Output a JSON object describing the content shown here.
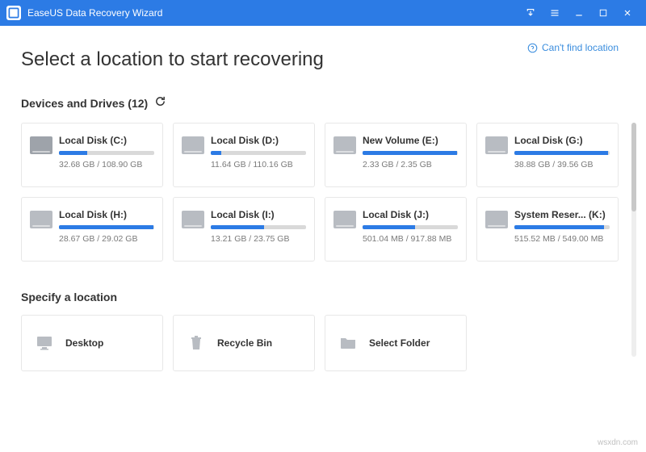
{
  "titlebar": {
    "app_name": "EaseUS Data Recovery Wizard"
  },
  "help_link": "Can't find location",
  "heading": "Select a location to start recovering",
  "drives_section": {
    "title": "Devices and Drives (12)"
  },
  "drives": [
    {
      "name": "Local Disk (C:)",
      "used": "32.68 GB",
      "total": "108.90 GB",
      "pct": 30,
      "os": true
    },
    {
      "name": "Local Disk (D:)",
      "used": "11.64 GB",
      "total": "110.16 GB",
      "pct": 11,
      "os": false
    },
    {
      "name": "New Volume (E:)",
      "used": "2.33 GB",
      "total": "2.35 GB",
      "pct": 99,
      "os": false
    },
    {
      "name": "Local Disk (G:)",
      "used": "38.88 GB",
      "total": "39.56 GB",
      "pct": 98,
      "os": false
    },
    {
      "name": "Local Disk (H:)",
      "used": "28.67 GB",
      "total": "29.02 GB",
      "pct": 99,
      "os": false
    },
    {
      "name": "Local Disk (I:)",
      "used": "13.21 GB",
      "total": "23.75 GB",
      "pct": 56,
      "os": false
    },
    {
      "name": "Local Disk (J:)",
      "used": "501.04 MB",
      "total": "917.88 MB",
      "pct": 55,
      "os": false
    },
    {
      "name": "System Reser... (K:)",
      "used": "515.52 MB",
      "total": "549.00 MB",
      "pct": 94,
      "os": false
    }
  ],
  "locations_section": {
    "title": "Specify a location"
  },
  "locations": [
    {
      "name": "Desktop",
      "icon": "desktop"
    },
    {
      "name": "Recycle Bin",
      "icon": "recycle"
    },
    {
      "name": "Select Folder",
      "icon": "folder"
    }
  ],
  "watermark": "wsxdn.com"
}
